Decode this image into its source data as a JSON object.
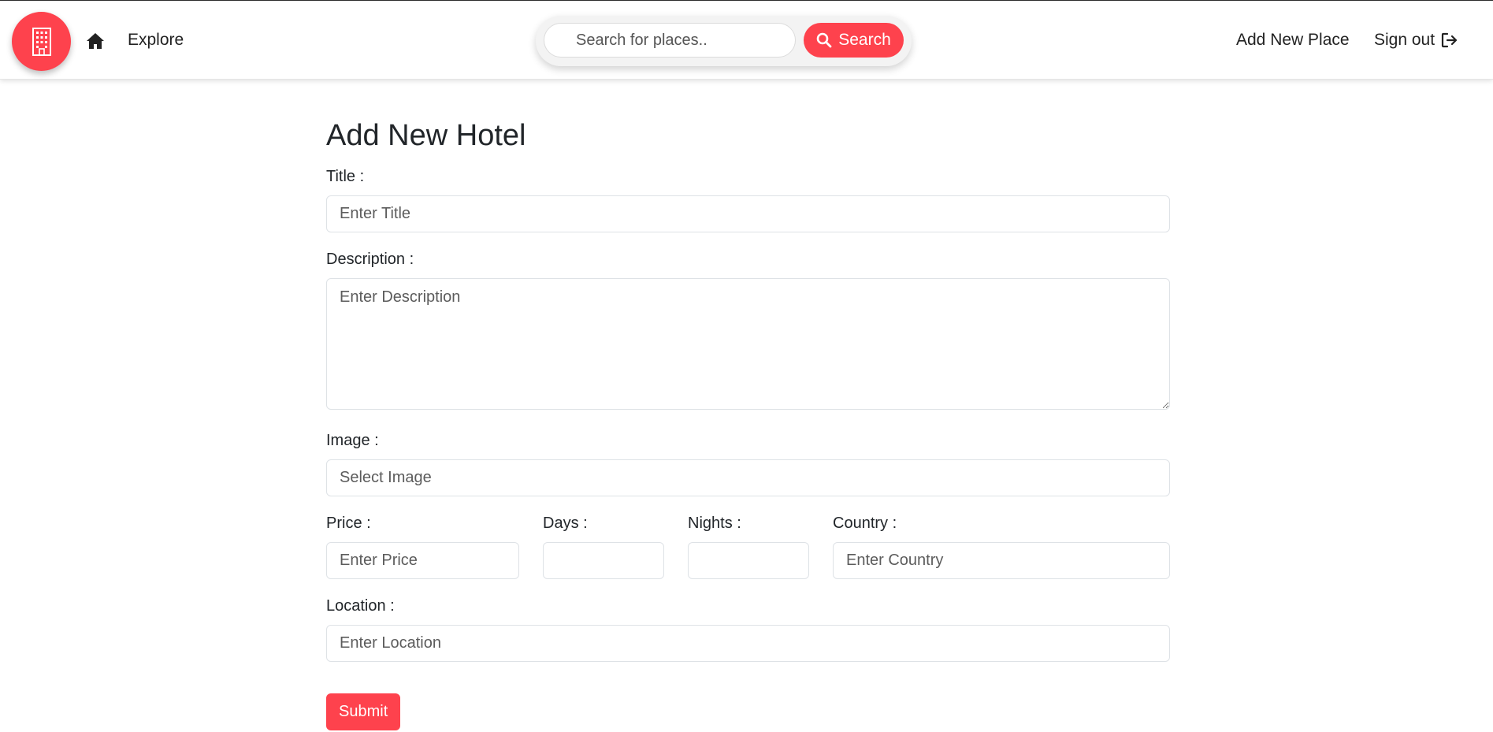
{
  "brand": {
    "icon": "hotel-building-icon",
    "color": "#fe424d"
  },
  "nav": {
    "home_icon": "home-icon",
    "explore": "Explore",
    "add_new_place": "Add New Place",
    "sign_out": "Sign out",
    "sign_out_icon": "sign-out-icon"
  },
  "search": {
    "placeholder": "Search for places..",
    "button_label": "Search",
    "button_icon": "search-icon"
  },
  "form": {
    "heading": "Add New Hotel",
    "title_label": "Title :",
    "title_placeholder": "Enter Title",
    "description_label": "Description :",
    "description_placeholder": "Enter Description",
    "image_label": "Image :",
    "image_placeholder": "Select Image",
    "price_label": "Price :",
    "price_placeholder": "Enter Price",
    "days_label": "Days :",
    "nights_label": "Nights :",
    "country_label": "Country :",
    "country_placeholder": "Enter Country",
    "location_label": "Location :",
    "location_placeholder": "Enter Location",
    "submit_label": "Submit"
  },
  "colors": {
    "accent": "#fe424d",
    "text": "#212529",
    "border": "#dee2e6"
  }
}
